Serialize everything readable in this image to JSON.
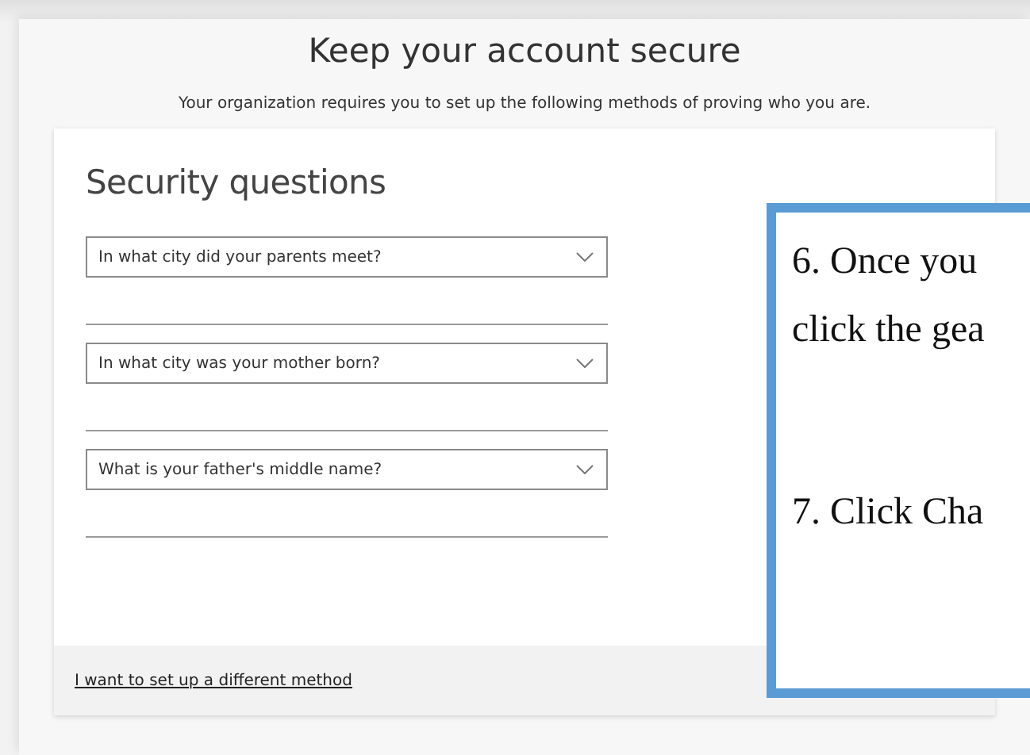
{
  "page": {
    "title": "Keep your account secure",
    "subtitle": "Your organization requires you to set up the following methods of proving who you are."
  },
  "card": {
    "heading": "Security questions",
    "questions": [
      {
        "question": "In what city did your parents meet?"
      },
      {
        "question": "In what city was your mother born?"
      },
      {
        "question": "What is your father's middle name?"
      }
    ],
    "footer_link": "I want to set up a different method"
  },
  "callout": {
    "lines": [
      "6. Once you",
      "click the gea",
      "7. Click Cha"
    ]
  }
}
